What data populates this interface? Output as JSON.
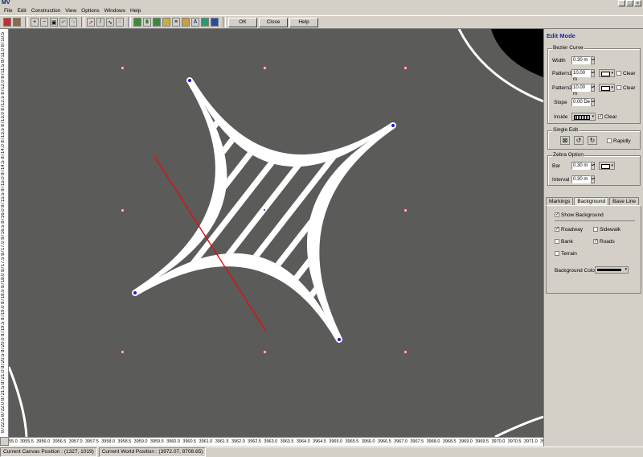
{
  "app": {
    "logo": "MV"
  },
  "window_controls": [
    "_",
    "□",
    "×"
  ],
  "menu": [
    "File",
    "Edit",
    "Construction",
    "View",
    "Options",
    "Windows",
    "Help"
  ],
  "toolbar": {
    "icons": [
      "book-icon",
      "trash-icon",
      "zoom-in-icon",
      "zoom-out-icon",
      "zoom-fit-icon",
      "undo-icon",
      "redo-icon",
      "select-arrow-icon",
      "pencil-icon",
      "curve-icon",
      "lasso-icon",
      "rect-icon",
      "oval-icon",
      "box-icon",
      "hatch-icon",
      "line-icon",
      "bars-icon",
      "text-icon",
      "image-icon",
      "save-icon"
    ],
    "ok_label": "OK",
    "close_label": "Close",
    "help_label": "Help"
  },
  "rulers": {
    "vertical_text": "8722.5 8722.0 8721.5 8721.0 8720.5 8720.0 8719.5 8719.0 8718.5 8718.0 8717.5 8717.0 8716.5 8716.0 8715.5 8715.0 8714.5 8714.0 8713.5 8713.0 8712.5 8712.0 8711.5 8711.0 8710.5",
    "horizontal_ticks": [
      "55.0",
      "3955.5",
      "3956.0",
      "3956.5",
      "3957.0",
      "3957.5",
      "3958.0",
      "3958.5",
      "3959.0",
      "3959.5",
      "3960.0",
      "3960.5",
      "3961.0",
      "3961.5",
      "3962.0",
      "3962.5",
      "3963.0",
      "3963.5",
      "3964.0",
      "3964.5",
      "3965.0",
      "3965.5",
      "3966.0",
      "3966.5",
      "3967.0",
      "3967.5",
      "3968.0",
      "3968.5",
      "3969.0",
      "3969.5",
      "3970.0",
      "3970.5",
      "3971.0",
      "3971.5",
      "39"
    ]
  },
  "status": {
    "canvas_position": "Current Canvas Position : (1327, 1019)",
    "world_position": "Current World Position : (3972.07, 8708.65)"
  },
  "panel": {
    "title": "Edit Mode",
    "bezier": {
      "legend": "Bezier Curve",
      "width_label": "Width",
      "width_value": "0.30 m",
      "pattern1_label": "Pattern1",
      "pattern1_value": "10.00 m",
      "pattern2_label": "Pattern2",
      "pattern2_value": "10.00 m",
      "slope_label": "Slope",
      "slope_value": "0.00 De",
      "inside_label": "Inside",
      "clear_label": "Clear",
      "pattern1_clear": false,
      "pattern2_clear": false,
      "width_clear": false,
      "inside_clear": true
    },
    "single_edit": {
      "legend": "Single Edit",
      "rapidly_label": "Rapidly"
    },
    "zebra": {
      "legend": "Zebra Option",
      "bar_label": "Bar",
      "bar_value": "0.30 m",
      "interval_label": "Interval",
      "interval_value": "0.30 m"
    },
    "tabs": [
      "Markings",
      "Background",
      "Base Line"
    ],
    "active_tab": "Background",
    "background": {
      "show_label": "Show Background",
      "roadway_label": "Roadway",
      "sidewalk_label": "Sidewalk",
      "bank_label": "Bank",
      "roads_label": "Roads",
      "terrain_label": "Terrain",
      "color_label": "Background Color",
      "color": "#000000"
    }
  }
}
